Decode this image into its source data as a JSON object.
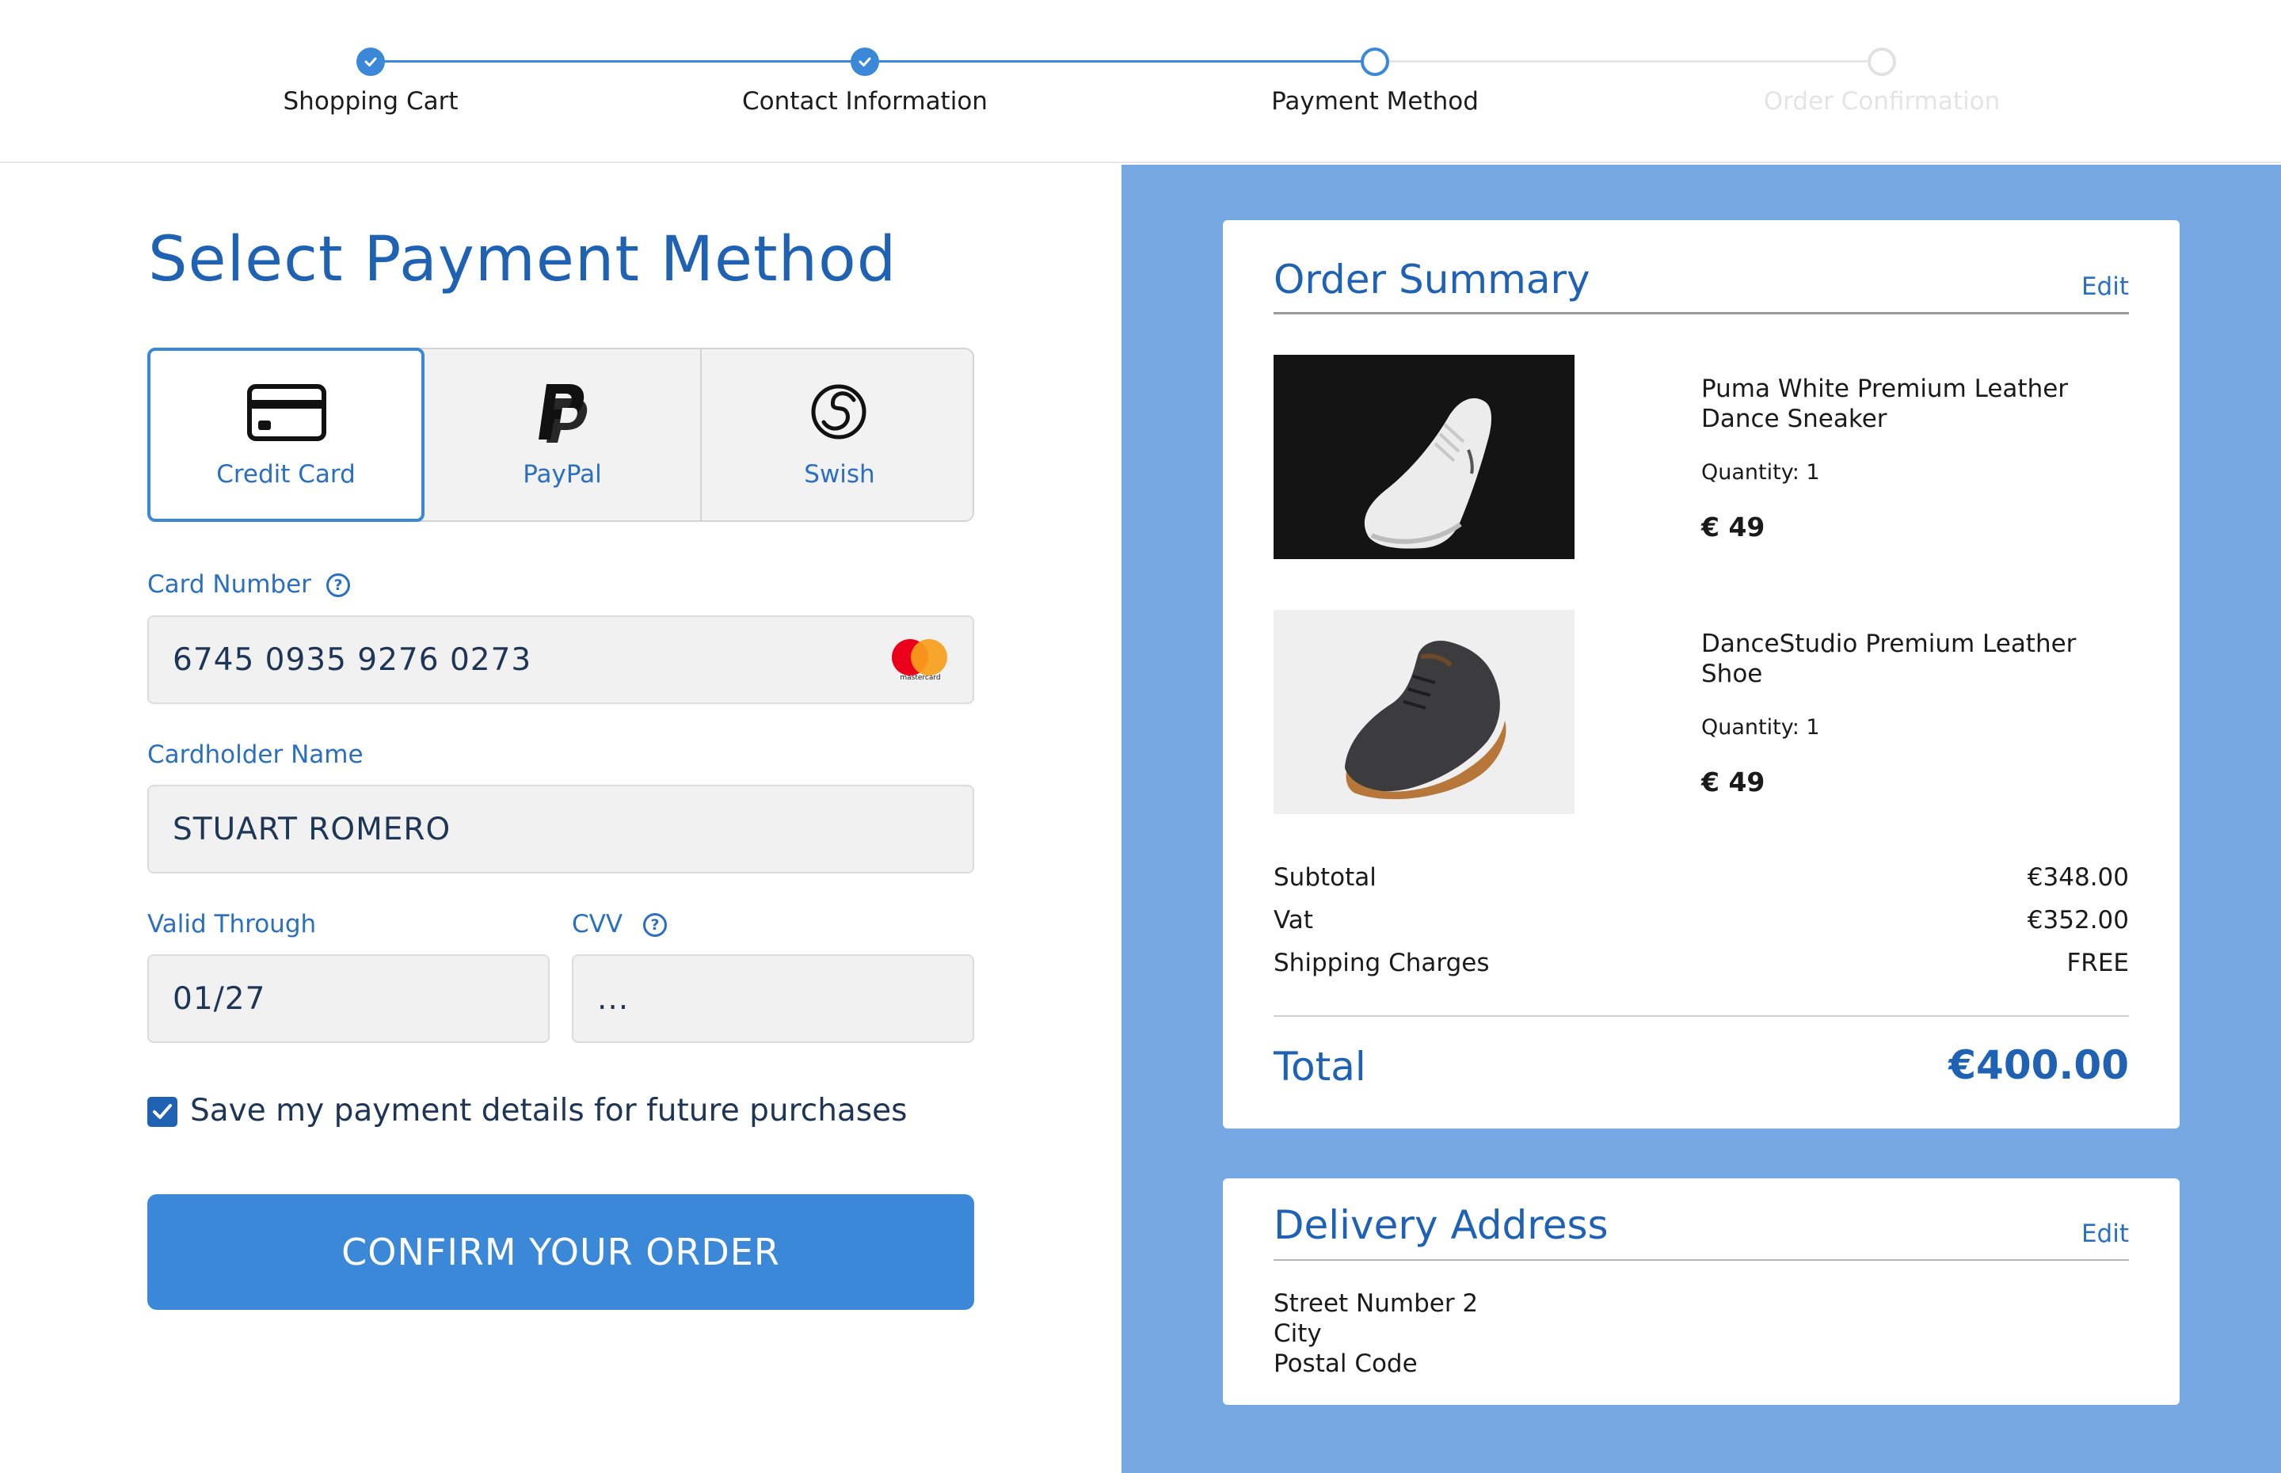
{
  "stepper": {
    "steps": [
      {
        "label": "Shopping Cart",
        "state": "done"
      },
      {
        "label": "Contact Information",
        "state": "done"
      },
      {
        "label": "Payment Method",
        "state": "current"
      },
      {
        "label": "Order Confirmation",
        "state": "todo"
      }
    ]
  },
  "payment": {
    "title": "Select Payment Method",
    "methods": [
      {
        "label": "Credit Card",
        "icon": "credit-card-icon",
        "selected": true
      },
      {
        "label": "PayPal",
        "icon": "paypal-icon",
        "selected": false
      },
      {
        "label": "Swish",
        "icon": "swish-icon",
        "selected": false
      }
    ],
    "card_number": {
      "label": "Card Number",
      "value": "6745 0935 9276 0273",
      "brand": "mastercard"
    },
    "cardholder": {
      "label": "Cardholder Name",
      "value": "STUART ROMERO"
    },
    "valid_through": {
      "label": "Valid Through",
      "value": "01/27"
    },
    "cvv": {
      "label": "CVV",
      "value": "..."
    },
    "save_details": {
      "label": "Save my payment details for future purchases",
      "checked": true
    },
    "confirm_label": "CONFIRM YOUR ORDER"
  },
  "order_summary": {
    "title": "Order Summary",
    "edit_label": "Edit",
    "items": [
      {
        "name": "Puma White Premium Leather Dance Sneaker",
        "quantity": "Quantity: 1",
        "price": "€ 49"
      },
      {
        "name": "DanceStudio Premium Leather Shoe",
        "quantity": "Quantity: 1",
        "price": "€ 49"
      }
    ],
    "subtotal_label": "Subtotal",
    "subtotal_value": "€348.00",
    "vat_label": "Vat",
    "vat_value": "€352.00",
    "shipping_label": "Shipping Charges",
    "shipping_value": "FREE",
    "total_label": "Total",
    "total_value": "€400.00"
  },
  "delivery": {
    "title": "Delivery Address",
    "edit_label": "Edit",
    "lines": [
      "Street Number 2",
      "City",
      "Postal Code"
    ]
  },
  "colors": {
    "primary": "#3b88d8",
    "heading": "#1f62b3",
    "panel_bg": "#76a9e3"
  }
}
